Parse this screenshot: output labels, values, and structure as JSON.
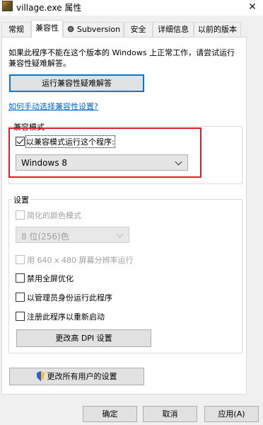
{
  "window": {
    "title": "village.exe 属性",
    "close_glyph": "✕",
    "app_icon": "village-app-icon"
  },
  "tabs": [
    {
      "label": "常规"
    },
    {
      "label": "兼容性",
      "active": true
    },
    {
      "label": "Subversion",
      "icon": "subversion-icon"
    },
    {
      "label": "安全"
    },
    {
      "label": "详细信息"
    },
    {
      "label": "以前的版本"
    }
  ],
  "intro_text": "如果此程序不能在这个版本的 Windows 上正常工作，请尝试运行兼容性疑难解答。",
  "troubleshoot_button": "运行兼容性疑难解答",
  "manual_link": "如何手动选择兼容性设置?",
  "compat_mode": {
    "group_label": "兼容模式",
    "checkbox_label": "以兼容模式运行这个程序:",
    "checked": true,
    "selected_os": "Windows 8"
  },
  "settings": {
    "group_label": "设置",
    "reduced_color_label": "简化的颜色模式",
    "color_select_value": "8 位(256)色",
    "resolution_label": "用 640 x 480 屏幕分辨率运行",
    "disable_fullscreen_label": "禁用全屏优化",
    "run_as_admin_label": "以管理员身份运行此程序",
    "register_restart_label": "注册此程序以重新启动",
    "dpi_button": "更改高 DPI 设置"
  },
  "all_users_button": "更改所有用户的设置",
  "footer": {
    "ok": "确定",
    "cancel": "取消",
    "apply": "应用(A)"
  },
  "colors": {
    "link": "#0066cc",
    "highlight_border": "#e02020",
    "focus_blue": "#0078d7"
  }
}
